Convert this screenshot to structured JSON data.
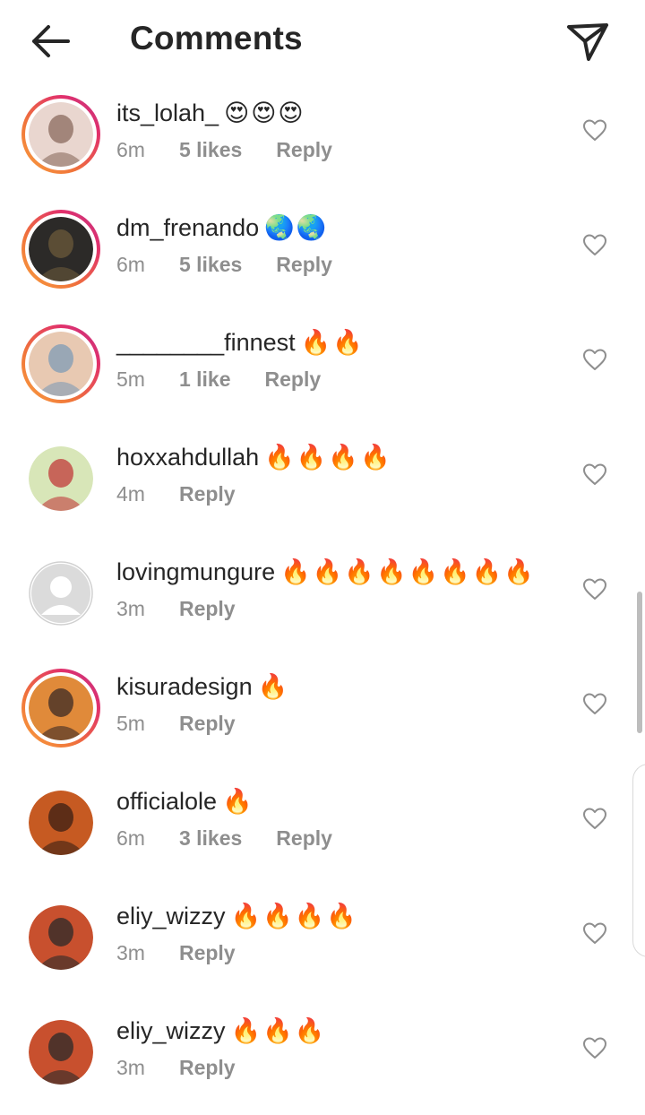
{
  "header": {
    "title": "Comments"
  },
  "comments": [
    {
      "username": "its_lolah_",
      "emojis": "😍😍😍",
      "time": "6m",
      "likes": "5 likes",
      "reply": "Reply",
      "story_ring": true,
      "avatar_colors": [
        "#e9d6cf",
        "#8a6a5d"
      ]
    },
    {
      "username": "dm_frenando",
      "emojis": "🌏🌏",
      "time": "6m",
      "likes": "5 likes",
      "reply": "Reply",
      "story_ring": true,
      "avatar_colors": [
        "#2c2a28",
        "#6b5a3a"
      ]
    },
    {
      "username": "________finnest",
      "emojis": "🔥🔥",
      "time": "5m",
      "likes": "1 like",
      "reply": "Reply",
      "story_ring": true,
      "avatar_colors": [
        "#e8c9b2",
        "#7f9bb5"
      ]
    },
    {
      "username": "hoxxahdullah",
      "emojis": "🔥🔥🔥🔥",
      "time": "4m",
      "likes": "",
      "reply": "Reply",
      "story_ring": false,
      "avatar_colors": [
        "#d8e6b8",
        "#c23a3a"
      ]
    },
    {
      "username": "lovingmungure",
      "emojis": "🔥🔥🔥🔥🔥🔥🔥🔥",
      "time": "3m",
      "likes": "",
      "reply": "Reply",
      "story_ring": false,
      "avatar_colors": [
        "#dbdbdb",
        "#ffffff"
      ]
    },
    {
      "username": "kisuradesign",
      "emojis": "🔥",
      "time": "5m",
      "likes": "",
      "reply": "Reply",
      "story_ring": true,
      "avatar_colors": [
        "#e08a3a",
        "#3b2a25"
      ]
    },
    {
      "username": "officialole",
      "emojis": "🔥",
      "time": "6m",
      "likes": "3 likes",
      "reply": "Reply",
      "story_ring": false,
      "avatar_colors": [
        "#c65a22",
        "#3a1f14"
      ]
    },
    {
      "username": "eliy_wizzy",
      "emojis": "🔥🔥🔥🔥",
      "time": "3m",
      "likes": "",
      "reply": "Reply",
      "story_ring": false,
      "avatar_colors": [
        "#c8502e",
        "#2a2a2a"
      ]
    },
    {
      "username": "eliy_wizzy",
      "emojis": "🔥🔥🔥",
      "time": "3m",
      "likes": "",
      "reply": "Reply",
      "story_ring": false,
      "avatar_colors": [
        "#c8502e",
        "#2a2a2a"
      ]
    }
  ],
  "icons": {
    "back": "arrow-left-icon",
    "send": "paper-plane-icon",
    "like": "heart-outline-icon"
  }
}
